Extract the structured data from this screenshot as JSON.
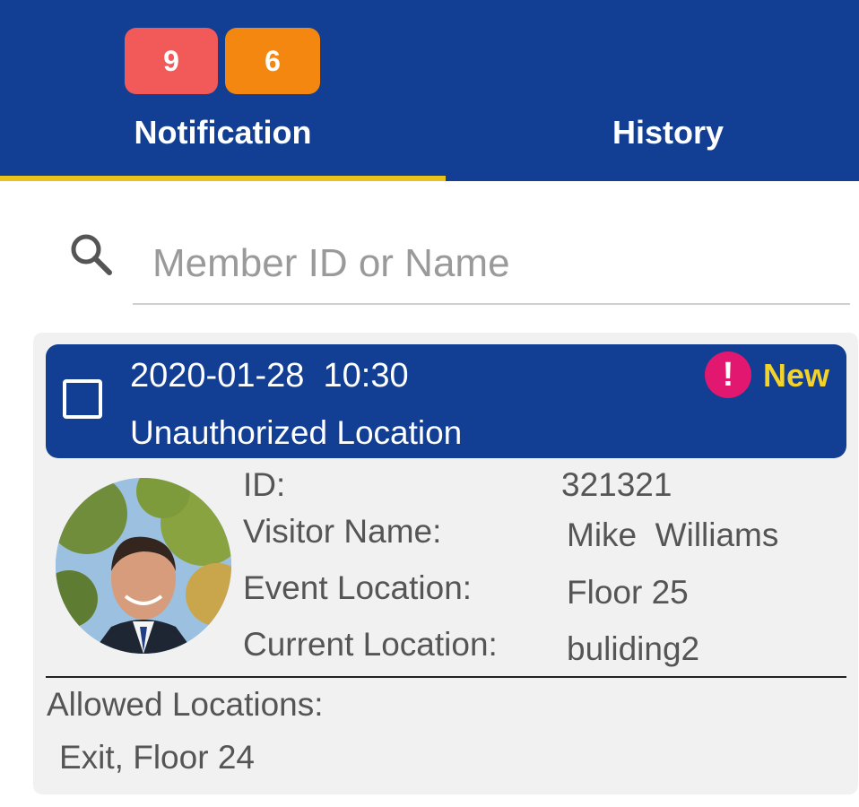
{
  "tabs": {
    "notification": {
      "label": "Notification",
      "badges": [
        {
          "count": "9",
          "color": "#f25a5a"
        },
        {
          "count": "6",
          "color": "#f4870f"
        }
      ]
    },
    "history": {
      "label": "History"
    },
    "active_tab": "notification"
  },
  "search": {
    "placeholder": "Member ID or Name",
    "value": "",
    "icon": "search-icon"
  },
  "alert_card": {
    "selected": false,
    "timestamp": "2020-01-28  10:30",
    "event_type": "Unauthorized Location",
    "status_icon": "exclamation-icon",
    "status": "New",
    "avatar": "visitor-photo",
    "fields": [
      {
        "label": "ID:",
        "value": "321321"
      },
      {
        "label": "Visitor Name:",
        "value": "Mike  Williams"
      },
      {
        "label": "Event Location:",
        "value": "Floor 25"
      },
      {
        "label": "Current Location:",
        "value": "buliding2"
      }
    ],
    "allowed_locations_label": "Allowed Locations:",
    "allowed_locations": "Exit, Floor 24"
  },
  "colors": {
    "brand_blue": "#123f93",
    "tab_indicator": "#e9c21b",
    "status_new": "#f3d32a",
    "alert_icon": "#e21870"
  }
}
